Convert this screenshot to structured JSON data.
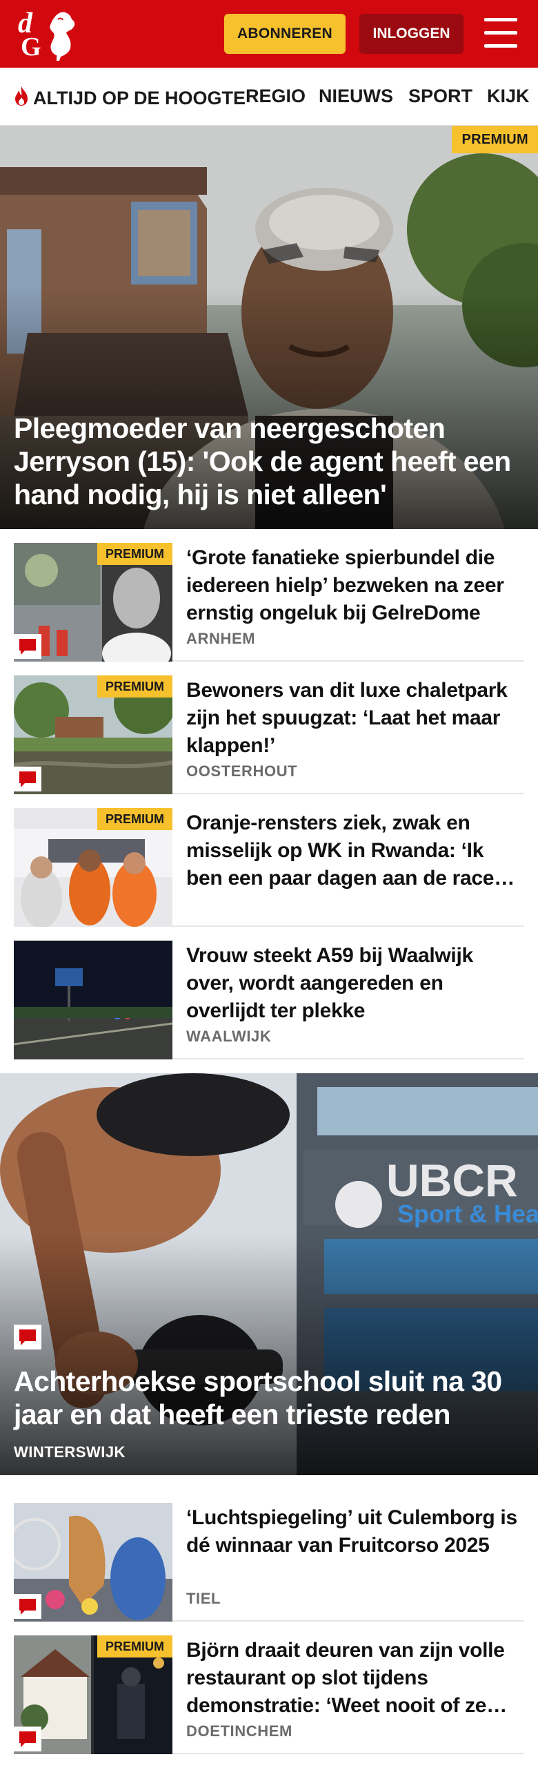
{
  "header": {
    "logo_text_d": "d",
    "logo_text_g": "G",
    "subscribe_label": "ABONNEREN",
    "login_label": "INLOGGEN",
    "brand_color": "#d2080f",
    "accent_color": "#f7c12d"
  },
  "nav": {
    "items": [
      {
        "label": "ALTIJD OP DE HOOGTE",
        "icon": "flame-icon"
      },
      {
        "label": "REGIO"
      },
      {
        "label": "NIEUWS"
      },
      {
        "label": "SPORT"
      },
      {
        "label": "KIJK"
      }
    ]
  },
  "hero_top": {
    "badge": "PREMIUM",
    "title": "Pleegmoeder van neergeschoten Jerryson (15): 'Ook de agent heeft een hand nodig, hij is niet alleen'"
  },
  "articles_a": [
    {
      "badge": "PREMIUM",
      "title": "‘Grote fanatieke spierbundel die iedereen hielp’ bezweken na zeer ernstig ongeluk bij GelreDome",
      "city": "ARNHEM",
      "comment_icon": "comment-icon"
    },
    {
      "badge": "PREMIUM",
      "title": "Bewoners van dit luxe chaletpark zijn het spuugzat: ‘Laat het maar klappen!’",
      "city": "OOSTERHOUT",
      "comment_icon": "comment-icon"
    },
    {
      "badge": "PREMIUM",
      "title": "Oranje-rensters ziek, zwak en misselijk op WK in Rwanda: ‘Ik ben een paar dagen aan de race afgezien’",
      "city": ""
    },
    {
      "badge": "",
      "title": "Vrouw steekt A59 bij Waalwijk over, wordt aangereden en overlijdt ter plekke",
      "city": "WAALWIJK"
    }
  ],
  "hero_mid": {
    "title": "Achterhoekse sportschool sluit na 30 jaar en dat heeft een trieste reden",
    "city": "WINTERSWIJK",
    "sign_text_1": "UBCR",
    "sign_text_2": "Sport & Heal"
  },
  "articles_b": [
    {
      "badge": "",
      "title": "‘Luchtspiegeling’ uit Culemborg is dé winnaar van Fruitcorso 2025",
      "city": "TIEL",
      "comment_icon": "comment-icon"
    },
    {
      "badge": "PREMIUM",
      "title": "Björn draait deuren van zijn volle restaurant op slot tijdens demonstratie: ‘Weet nooit of ze hier ook komen’",
      "city": "DOETINCHEM",
      "comment_icon": "comment-icon"
    }
  ]
}
